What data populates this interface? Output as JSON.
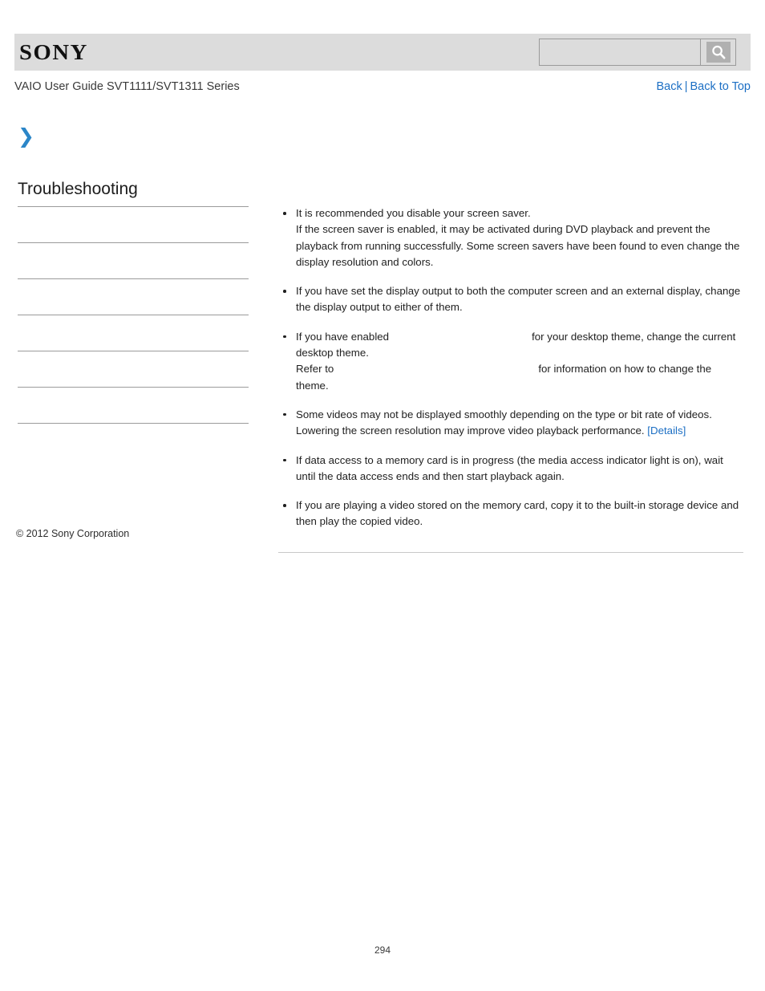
{
  "header": {
    "logo_text": "SONY",
    "search": {
      "value": "",
      "placeholder": "",
      "button_icon": "search-icon"
    }
  },
  "sub_header": {
    "guide_title": "VAIO User Guide SVT1111/SVT1311 Series",
    "nav": {
      "back_label": "Back",
      "separator": "|",
      "back_to_top_label": "Back to Top"
    }
  },
  "sidebar": {
    "chevron_icon": "chevron-right-icon",
    "section_title": "Troubleshooting",
    "items": [
      {
        "label": ""
      },
      {
        "label": ""
      },
      {
        "label": ""
      },
      {
        "label": ""
      },
      {
        "label": ""
      },
      {
        "label": ""
      }
    ]
  },
  "content": {
    "bullets": [
      {
        "lines": [
          "It is recommended you disable your screen saver.",
          "If the screen saver is enabled, it may be activated during DVD playback and prevent the playback from running successfully. Some screen savers have been found to even change the display resolution and colors."
        ]
      },
      {
        "lines": [
          "If you have set the display output to both the computer screen and an external display, change the display output to either of them."
        ]
      },
      {
        "segments": {
          "part1": "If you have enabled",
          "gap1": "",
          "part2": "for your desktop theme, change the current desktop theme.",
          "part3": "Refer to",
          "gap2": "",
          "part4": "for information on how to change the theme."
        }
      },
      {
        "segments": {
          "text": "Some videos may not be displayed smoothly depending on the type or bit rate of videos. Lowering the screen resolution may improve video playback performance.",
          "link": "[Details]"
        }
      },
      {
        "lines": [
          "If data access to a memory card is in progress (the media access indicator light is on), wait until the data access ends and then start playback again."
        ]
      },
      {
        "lines": [
          "If you are playing a video stored on the memory card, copy it to the built-in storage device and then play the copied video."
        ]
      }
    ]
  },
  "footer": {
    "copyright": "© 2012 Sony Corporation",
    "page_number": "294"
  },
  "colors": {
    "link": "#1c6fc4",
    "header_bg": "#dcdcdc",
    "chevron": "#2b86c8",
    "rule": "#9b9b9b"
  }
}
